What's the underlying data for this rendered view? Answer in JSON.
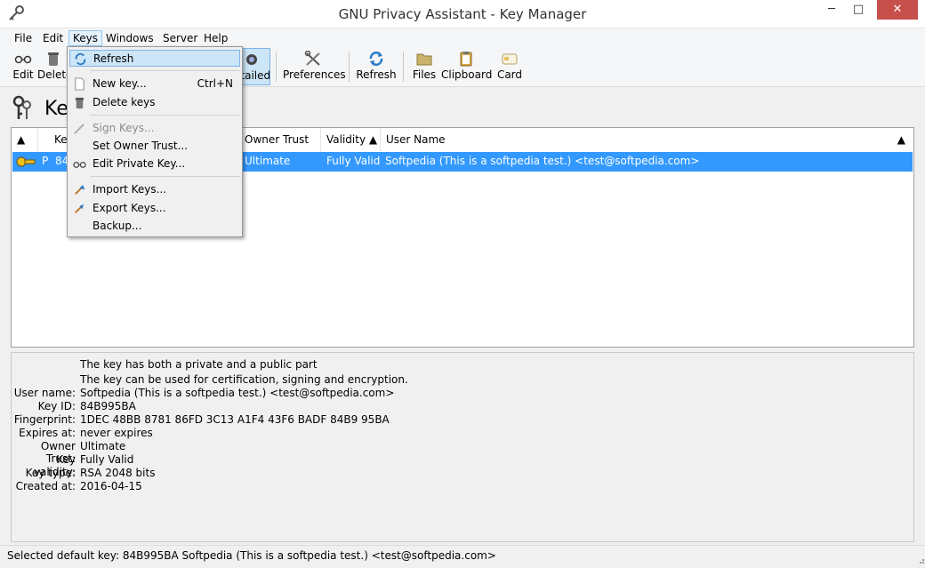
{
  "window": {
    "title": "GNU Privacy Assistant - Key Manager",
    "min_label": "─",
    "max_label": "□",
    "close_label": "✕"
  },
  "menubar": [
    "File",
    "Edit",
    "Keys",
    "Windows",
    "Server",
    "Help"
  ],
  "toolbar": {
    "edit": "Edit",
    "delete": "Delete",
    "detailed": "etailed",
    "preferences": "Preferences",
    "refresh": "Refresh",
    "files": "Files",
    "clipboard": "Clipboard",
    "card": "Card"
  },
  "header": {
    "title": "Key"
  },
  "table": {
    "columns": [
      "",
      "Ke",
      "Owner Trust",
      "Validity",
      "User Name"
    ],
    "row": {
      "key_prefix": "P",
      "key_id": "84",
      "owner_trust": "Ultimate",
      "validity": "Fully Valid",
      "user_name": "Softpedia (This is a softpedia test.) <test@softpedia.com>"
    }
  },
  "keys_menu": {
    "refresh": "Refresh",
    "new_key": "New key...",
    "new_key_shortcut": "Ctrl+N",
    "delete_keys": "Delete keys",
    "sign_keys": "Sign Keys...",
    "set_owner_trust": "Set Owner Trust...",
    "edit_private_key": "Edit Private Key...",
    "import_keys": "Import Keys...",
    "export_keys": "Export Keys...",
    "backup": "Backup..."
  },
  "details": {
    "line1": "The key has both a private and a public part",
    "line2": "The key can be used for certification, signing and encryption.",
    "labels": {
      "user_name": "User name:",
      "key_id": "Key ID:",
      "fingerprint": "Fingerprint:",
      "expires": "Expires at:",
      "owner_trust": "Owner Trust:",
      "validity": "Key validity:",
      "type": "Key type:",
      "created": "Created at:"
    },
    "values": {
      "user_name": "Softpedia (This is a softpedia test.) <test@softpedia.com>",
      "key_id": "84B995BA",
      "fingerprint": "1DEC 48BB 8781 86FD 3C13  A1F4 43F6 BADF 84B9 95BA",
      "expires": "never expires",
      "owner_trust": "Ultimate",
      "validity": "Fully Valid",
      "type": "RSA 2048 bits",
      "created": "2016-04-15"
    }
  },
  "status": {
    "text": "Selected default key:  84B995BA  Softpedia (This is a softpedia test.) <test@softpedia.com>"
  },
  "colors": {
    "selection": "#3399ff",
    "menu_hover": "#cde6f7",
    "close_button": "#c7504d"
  }
}
